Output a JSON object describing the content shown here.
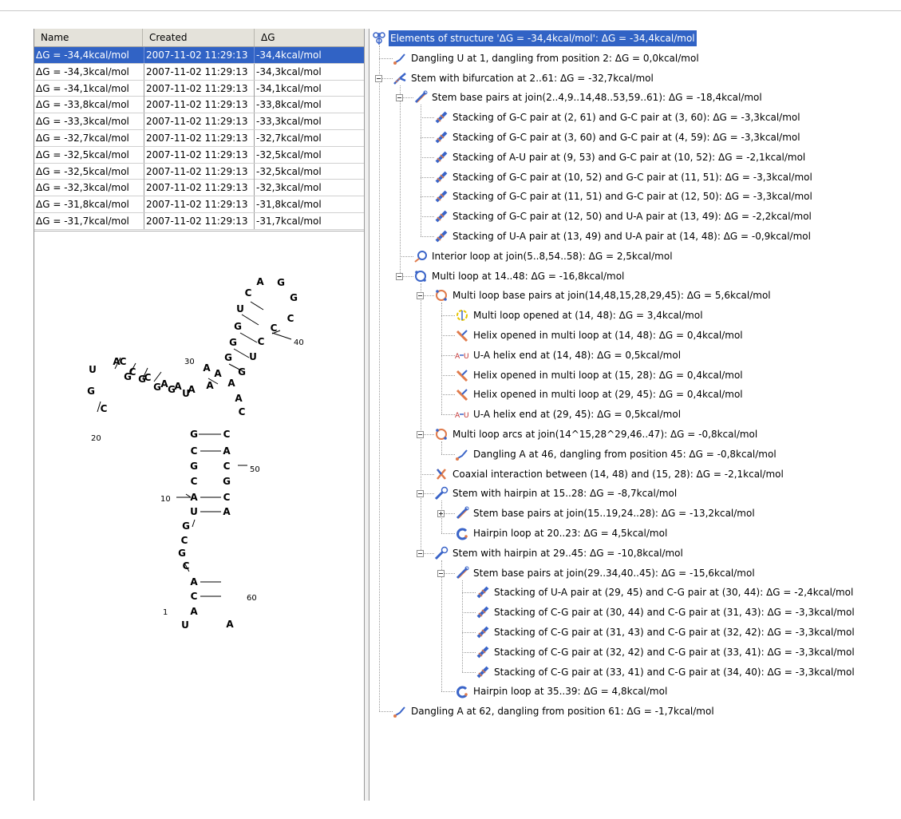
{
  "table": {
    "columns": [
      "Name",
      "Created",
      "ΔG"
    ],
    "rows": [
      [
        "ΔG = -34,4kcal/mol",
        "2007-11-02 11:29:13",
        "-34,4kcal/mol"
      ],
      [
        "ΔG = -34,3kcal/mol",
        "2007-11-02 11:29:13",
        "-34,3kcal/mol"
      ],
      [
        "ΔG = -34,1kcal/mol",
        "2007-11-02 11:29:13",
        "-34,1kcal/mol"
      ],
      [
        "ΔG = -33,8kcal/mol",
        "2007-11-02 11:29:13",
        "-33,8kcal/mol"
      ],
      [
        "ΔG = -33,3kcal/mol",
        "2007-11-02 11:29:13",
        "-33,3kcal/mol"
      ],
      [
        "ΔG = -32,7kcal/mol",
        "2007-11-02 11:29:13",
        "-32,7kcal/mol"
      ],
      [
        "ΔG = -32,5kcal/mol",
        "2007-11-02 11:29:13",
        "-32,5kcal/mol"
      ],
      [
        "ΔG = -32,5kcal/mol",
        "2007-11-02 11:29:13",
        "-32,5kcal/mol"
      ],
      [
        "ΔG = -32,3kcal/mol",
        "2007-11-02 11:29:13",
        "-32,3kcal/mol"
      ],
      [
        "ΔG = -31,8kcal/mol",
        "2007-11-02 11:29:13",
        "-31,8kcal/mol"
      ],
      [
        "ΔG = -31,7kcal/mol",
        "2007-11-02 11:29:13",
        "-31,7kcal/mol"
      ]
    ],
    "selected_row": 0
  },
  "structure": {
    "bases": [
      "A",
      "G",
      "C",
      "G",
      "U",
      "C",
      "G",
      "C",
      "G",
      "C",
      "G",
      "U",
      "A",
      "G",
      "A",
      "A",
      "A",
      "C",
      "C",
      "C",
      "C",
      "A",
      "A",
      "A",
      "G",
      "G",
      "G",
      "G",
      "U",
      "A",
      "U",
      "A",
      "G",
      "C",
      "G",
      "C",
      "G",
      "C",
      "A",
      "U",
      "A",
      "C",
      "A",
      "C",
      "A",
      "C",
      "G",
      "C",
      "A",
      "G",
      "C",
      "G",
      "C",
      "U",
      "A"
    ],
    "position_labels": [
      "40",
      "30",
      "20",
      "50",
      "10",
      "60",
      "1"
    ]
  },
  "tree": {
    "nodes": [
      {
        "depth": 0,
        "icon": "structure-root-icon",
        "label": "Elements of structure 'ΔG = -34,4kcal/mol': ΔG = -34,4kcal/mol",
        "selected": true,
        "expander": "none"
      },
      {
        "depth": 1,
        "icon": "dangling-icon",
        "label": "Dangling U at 1, dangling from position 2: ΔG = 0,0kcal/mol",
        "expander": "none"
      },
      {
        "depth": 1,
        "icon": "stem-bifurcation-icon",
        "label": "Stem with bifurcation at 2..61: ΔG = -32,7kcal/mol",
        "expander": "minus"
      },
      {
        "depth": 2,
        "icon": "stem-base-pairs-icon",
        "label": "Stem base pairs at join(2..4,9..14,48..53,59..61): ΔG = -18,4kcal/mol",
        "expander": "minus"
      },
      {
        "depth": 3,
        "icon": "stacking-icon",
        "label": "Stacking of G-C pair at (2, 61) and G-C pair at (3, 60): ΔG = -3,3kcal/mol",
        "expander": "none"
      },
      {
        "depth": 3,
        "icon": "stacking-icon",
        "label": "Stacking of G-C pair at (3, 60) and G-C pair at (4, 59): ΔG = -3,3kcal/mol",
        "expander": "none"
      },
      {
        "depth": 3,
        "icon": "stacking-icon",
        "label": "Stacking of A-U pair at (9, 53) and G-C pair at (10, 52): ΔG = -2,1kcal/mol",
        "expander": "none"
      },
      {
        "depth": 3,
        "icon": "stacking-icon",
        "label": "Stacking of G-C pair at (10, 52) and G-C pair at (11, 51): ΔG = -3,3kcal/mol",
        "expander": "none"
      },
      {
        "depth": 3,
        "icon": "stacking-icon",
        "label": "Stacking of G-C pair at (11, 51) and G-C pair at (12, 50): ΔG = -3,3kcal/mol",
        "expander": "none"
      },
      {
        "depth": 3,
        "icon": "stacking-icon",
        "label": "Stacking of G-C pair at (12, 50) and U-A pair at (13, 49): ΔG = -2,2kcal/mol",
        "expander": "none"
      },
      {
        "depth": 3,
        "icon": "stacking-icon",
        "label": "Stacking of U-A pair at (13, 49) and U-A pair at (14, 48): ΔG = -0,9kcal/mol",
        "expander": "none"
      },
      {
        "depth": 2,
        "icon": "interior-loop-icon",
        "label": "Interior loop at join(5..8,54..58): ΔG = 2,5kcal/mol",
        "expander": "none"
      },
      {
        "depth": 2,
        "icon": "multi-loop-icon",
        "label": "Multi loop at 14..48: ΔG = -16,8kcal/mol",
        "expander": "minus"
      },
      {
        "depth": 3,
        "icon": "multi-loop-base-pairs-icon",
        "label": "Multi loop base pairs at join(14,48,15,28,29,45): ΔG = 5,6kcal/mol",
        "expander": "minus"
      },
      {
        "depth": 4,
        "icon": "multi-loop-opened-icon",
        "label": "Multi loop opened at (14, 48): ΔG = 3,4kcal/mol",
        "expander": "none"
      },
      {
        "depth": 4,
        "icon": "helix-opened-icon",
        "label": "Helix opened in multi loop at (14, 48): ΔG = 0,4kcal/mol",
        "expander": "none"
      },
      {
        "depth": 4,
        "icon": "helix-end-icon",
        "label": "U-A helix end at (14, 48): ΔG = 0,5kcal/mol",
        "expander": "none"
      },
      {
        "depth": 4,
        "icon": "helix-opened-icon",
        "label": "Helix opened in multi loop at (15, 28): ΔG = 0,4kcal/mol",
        "expander": "none"
      },
      {
        "depth": 4,
        "icon": "helix-opened-icon",
        "label": "Helix opened in multi loop at (29, 45): ΔG = 0,4kcal/mol",
        "expander": "none"
      },
      {
        "depth": 4,
        "icon": "helix-end-icon",
        "label": "U-A helix end at (29, 45): ΔG = 0,5kcal/mol",
        "expander": "none"
      },
      {
        "depth": 3,
        "icon": "multi-loop-arcs-icon",
        "label": "Multi loop arcs at join(14^15,28^29,46..47): ΔG = -0,8kcal/mol",
        "expander": "minus"
      },
      {
        "depth": 4,
        "icon": "dangling-icon",
        "label": "Dangling A at 46, dangling from position 45: ΔG = -0,8kcal/mol",
        "expander": "none"
      },
      {
        "depth": 3,
        "icon": "coaxial-icon",
        "label": "Coaxial interaction between (14, 48) and (15, 28): ΔG = -2,1kcal/mol",
        "expander": "none"
      },
      {
        "depth": 3,
        "icon": "stem-hairpin-icon",
        "label": "Stem with hairpin at 15..28: ΔG = -8,7kcal/mol",
        "expander": "minus"
      },
      {
        "depth": 4,
        "icon": "stem-base-pairs-icon",
        "label": "Stem base pairs at join(15..19,24..28): ΔG = -13,2kcal/mol",
        "expander": "plus"
      },
      {
        "depth": 4,
        "icon": "hairpin-loop-icon",
        "label": "Hairpin loop at 20..23: ΔG = 4,5kcal/mol",
        "expander": "none"
      },
      {
        "depth": 3,
        "icon": "stem-hairpin-icon",
        "label": "Stem with hairpin at 29..45: ΔG = -10,8kcal/mol",
        "expander": "minus"
      },
      {
        "depth": 4,
        "icon": "stem-base-pairs-icon",
        "label": "Stem base pairs at join(29..34,40..45): ΔG = -15,6kcal/mol",
        "expander": "minus"
      },
      {
        "depth": 5,
        "icon": "stacking-icon",
        "label": "Stacking of U-A pair at (29, 45) and C-G pair at (30, 44): ΔG = -2,4kcal/mol",
        "expander": "none"
      },
      {
        "depth": 5,
        "icon": "stacking-icon",
        "label": "Stacking of C-G pair at (30, 44) and C-G pair at (31, 43): ΔG = -3,3kcal/mol",
        "expander": "none"
      },
      {
        "depth": 5,
        "icon": "stacking-icon",
        "label": "Stacking of C-G pair at (31, 43) and C-G pair at (32, 42): ΔG = -3,3kcal/mol",
        "expander": "none"
      },
      {
        "depth": 5,
        "icon": "stacking-icon",
        "label": "Stacking of C-G pair at (32, 42) and C-G pair at (33, 41): ΔG = -3,3kcal/mol",
        "expander": "none"
      },
      {
        "depth": 5,
        "icon": "stacking-icon",
        "label": "Stacking of C-G pair at (33, 41) and C-G pair at (34, 40): ΔG = -3,3kcal/mol",
        "expander": "none"
      },
      {
        "depth": 4,
        "icon": "hairpin-loop-icon",
        "label": "Hairpin loop at 35..39: ΔG = 4,8kcal/mol",
        "expander": "none"
      },
      {
        "depth": 1,
        "icon": "dangling-icon",
        "label": "Dangling A at 62, dangling from position 61: ΔG = -1,7kcal/mol",
        "expander": "none"
      }
    ]
  },
  "colors": {
    "selection": "#3163c5",
    "icon_blue": "#3a64c8",
    "icon_orange": "#e07a4a",
    "helix_end_red": "#c03030"
  }
}
